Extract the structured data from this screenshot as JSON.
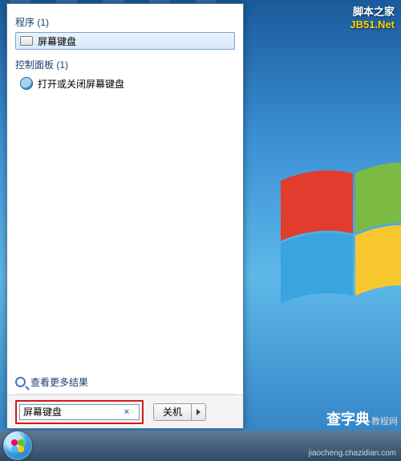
{
  "watermark": {
    "line1": "脚本之家",
    "line2": "JB51.Net"
  },
  "sections": {
    "programs": {
      "header": "程序 (1)",
      "items": [
        "屏幕键盘"
      ]
    },
    "controlPanel": {
      "header": "控制面板 (1)",
      "items": [
        "打开或关闭屏幕键盘"
      ]
    }
  },
  "seeMore": "查看更多结果",
  "search": {
    "value": "屏幕键盘",
    "clearGlyph": "×"
  },
  "shutdown": {
    "label": "关机"
  },
  "watermark_br": {
    "main": "查字典",
    "suffix": "教程网"
  },
  "watermark_url": "jiaocheng.chazidian.com"
}
